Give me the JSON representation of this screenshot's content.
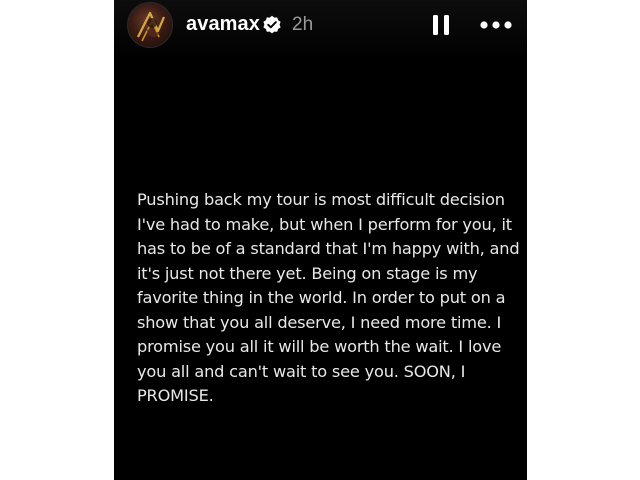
{
  "header": {
    "username": "avamax",
    "time_ago": "2h",
    "avatar_icon": "avatar-profile-photo",
    "verified_icon": "verified-badge-icon",
    "pause_icon": "pause-icon",
    "more_icon": "more-options-icon"
  },
  "story": {
    "text": "Pushing back my tour is most difficult decision\nI've had to make, but when I perform for you, it\nhas to be of a standard that I'm happy with, and\nit's just not there yet. Being on stage is my\nfavorite thing in the world. In order to put on a\nshow that you all deserve, I need more time. I\npromise you all it will be worth the wait. I love\nyou all and can't wait to see you. SOON, I\nPROMISE."
  },
  "colors": {
    "background": "#000000",
    "text": "#e8e8e8",
    "muted": "#9a9a9a"
  }
}
